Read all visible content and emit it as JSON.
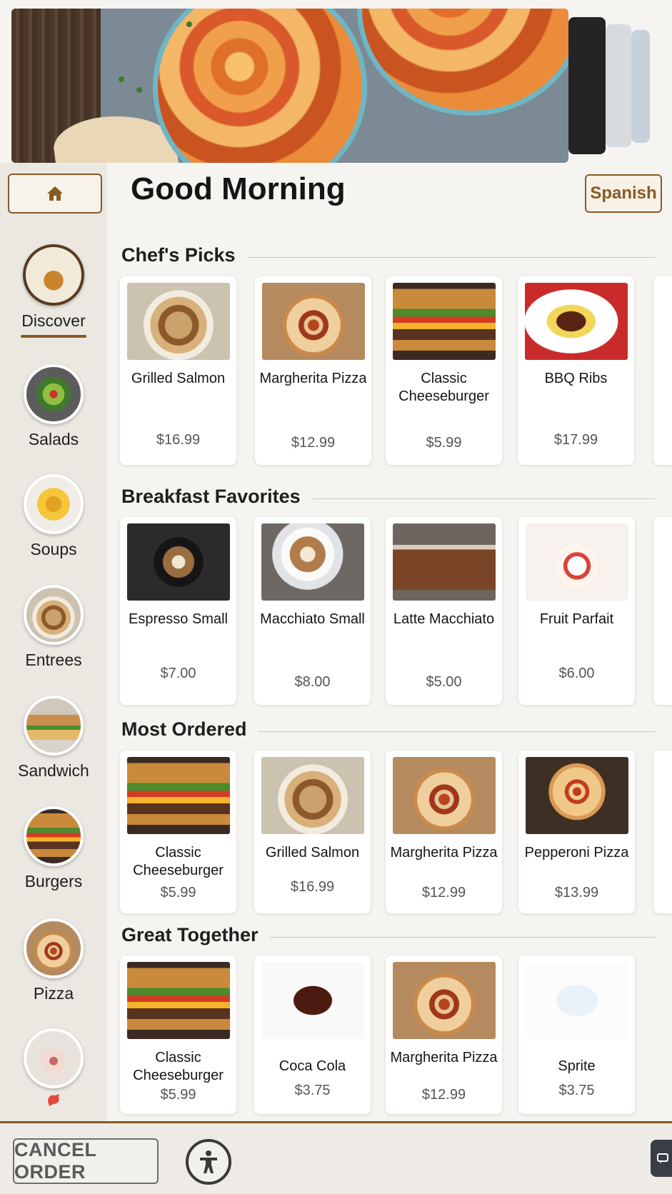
{
  "header": {
    "greeting": "Good Morning",
    "language_button": "Spanish"
  },
  "sidebar": {
    "categories": [
      {
        "label": "Discover",
        "icon": "discover-icon",
        "active": true
      },
      {
        "label": "Salads",
        "icon": "salads-icon"
      },
      {
        "label": "Soups",
        "icon": "soups-icon"
      },
      {
        "label": "Entrees",
        "icon": "entrees-icon"
      },
      {
        "label": "Sandwich",
        "icon": "sandwich-icon"
      },
      {
        "label": "Burgers",
        "icon": "burgers-icon"
      },
      {
        "label": "Pizza",
        "icon": "pizza-icon"
      },
      {
        "label": "",
        "icon": "desserts-icon"
      }
    ]
  },
  "sections": [
    {
      "title": "Chef's Picks",
      "items": [
        {
          "name": "Grilled Salmon",
          "price": "$16.99"
        },
        {
          "name": "Margherita Pizza",
          "price": "$12.99"
        },
        {
          "name": "Classic Cheeseburger",
          "price": "$5.99"
        },
        {
          "name": "BBQ Ribs",
          "price": "$17.99"
        }
      ]
    },
    {
      "title": "Breakfast Favorites",
      "items": [
        {
          "name": "Espresso Small",
          "price": "$7.00"
        },
        {
          "name": "Macchiato Small",
          "price": "$8.00"
        },
        {
          "name": "Latte Macchiato",
          "price": "$5.00"
        },
        {
          "name": "Fruit Parfait",
          "price": "$6.00"
        }
      ]
    },
    {
      "title": "Most Ordered",
      "items": [
        {
          "name": "Classic Cheeseburger",
          "price": "$5.99"
        },
        {
          "name": "Grilled Salmon",
          "price": "$16.99"
        },
        {
          "name": "Margherita Pizza",
          "price": "$12.99"
        },
        {
          "name": "Pepperoni Pizza",
          "price": "$13.99"
        }
      ]
    },
    {
      "title": "Great Together",
      "items": [
        {
          "name": "Classic Cheeseburger",
          "price": "$5.99"
        },
        {
          "name": "Coca Cola",
          "price": "$3.75"
        },
        {
          "name": "Margherita Pizza",
          "price": "$12.99"
        },
        {
          "name": "Sprite",
          "price": "$3.75"
        }
      ]
    }
  ],
  "footer": {
    "cancel_button": "CANCEL ORDER"
  },
  "colors": {
    "accent_brown": "#8b5a22",
    "background": "#f6f4f1",
    "sidebar": "#ebe8e2"
  }
}
